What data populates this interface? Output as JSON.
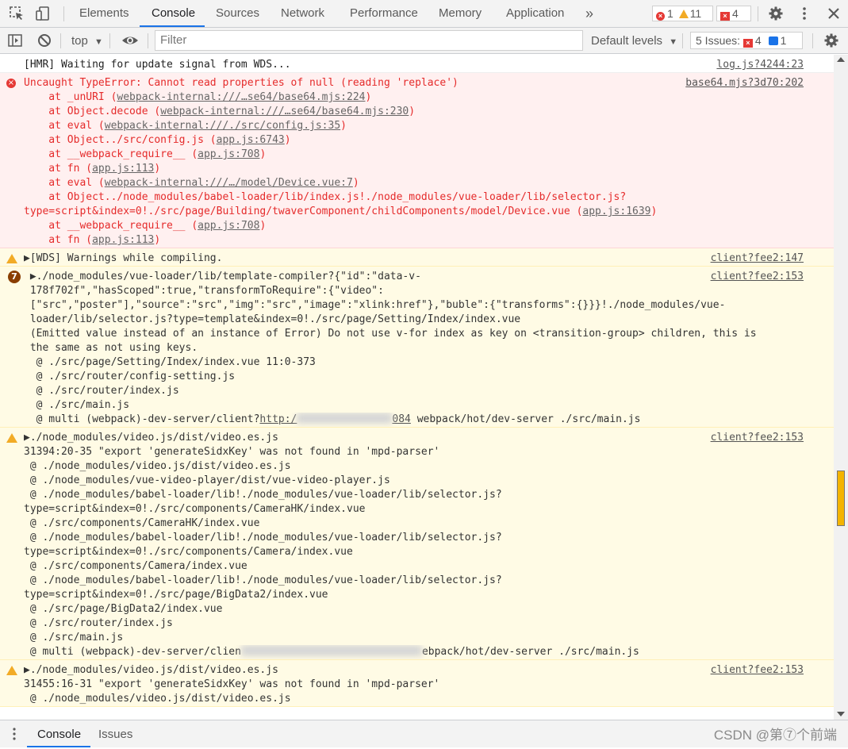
{
  "tabs": [
    "Elements",
    "Console",
    "Sources",
    "Network",
    "Performance",
    "Memory",
    "Application"
  ],
  "more_tabs_label": "»",
  "counts": {
    "errors": "1",
    "warnings": "11",
    "issues": "4"
  },
  "toolbar": {
    "context": "top",
    "filter_placeholder": "Filter",
    "levels": "Default levels",
    "issues_label": "5 Issues:",
    "issues_errors": "4",
    "issues_info": "1"
  },
  "messages": [
    {
      "type": "info",
      "source": "log.js?4244:23",
      "lines": [
        [
          {
            "t": "[HMR] Waiting for update signal from WDS..."
          }
        ]
      ]
    },
    {
      "type": "error",
      "source": "base64.mjs?3d70:202",
      "lines": [
        [
          {
            "t": "Uncaught TypeError: Cannot read properties of null (reading 'replace')"
          }
        ],
        [
          {
            "t": "    at _unURI ("
          },
          {
            "t": "webpack-internal:///…se64/base64.mjs:224",
            "link": true
          },
          {
            "t": ")"
          }
        ],
        [
          {
            "t": "    at Object.decode ("
          },
          {
            "t": "webpack-internal:///…se64/base64.mjs:230",
            "link": true
          },
          {
            "t": ")"
          }
        ],
        [
          {
            "t": "    at eval ("
          },
          {
            "t": "webpack-internal:///./src/config.js:35",
            "link": true
          },
          {
            "t": ")"
          }
        ],
        [
          {
            "t": "    at Object../src/config.js ("
          },
          {
            "t": "app.js:6743",
            "link": true
          },
          {
            "t": ")"
          }
        ],
        [
          {
            "t": "    at __webpack_require__ ("
          },
          {
            "t": "app.js:708",
            "link": true
          },
          {
            "t": ")"
          }
        ],
        [
          {
            "t": "    at fn ("
          },
          {
            "t": "app.js:113",
            "link": true
          },
          {
            "t": ")"
          }
        ],
        [
          {
            "t": "    at eval ("
          },
          {
            "t": "webpack-internal:///…/model/Device.vue:7",
            "link": true
          },
          {
            "t": ")"
          }
        ],
        [
          {
            "t": "    at Object../node_modules/babel-loader/lib/index.js!./node_modules/vue-loader/lib/selector.js?"
          }
        ],
        [
          {
            "t": "type=script&index=0!./src/page/Building/twaverComponent/childComponents/model/Device.vue ("
          },
          {
            "t": "app.js:1639",
            "link": true
          },
          {
            "t": ")"
          }
        ],
        [
          {
            "t": "    at __webpack_require__ ("
          },
          {
            "t": "app.js:708",
            "link": true
          },
          {
            "t": ")"
          }
        ],
        [
          {
            "t": "    at fn ("
          },
          {
            "t": "app.js:113",
            "link": true
          },
          {
            "t": ")"
          }
        ]
      ]
    },
    {
      "type": "warning",
      "source": "client?fee2:147",
      "lines": [
        [
          {
            "t": "▶[WDS] Warnings while compiling."
          }
        ]
      ]
    },
    {
      "type": "warning-count",
      "count": "7",
      "source": "client?fee2:153",
      "lines": [
        [
          {
            "t": " ▶./node_modules/vue-loader/lib/template-compiler?{\"id\":\"data-v-"
          }
        ],
        [
          {
            "t": " 178f702f\",\"hasScoped\":true,\"transformToRequire\":{\"video\":"
          }
        ],
        [
          {
            "t": " [\"src\",\"poster\"],\"source\":\"src\",\"img\":\"src\",\"image\":\"xlink:href\"},\"buble\":{\"transforms\":{}}}!./node_modules/vue-"
          }
        ],
        [
          {
            "t": " loader/lib/selector.js?type=template&index=0!./src/page/Setting/Index/index.vue"
          }
        ],
        [
          {
            "t": " (Emitted value instead of an instance of Error) Do not use v-for index as key on <transition-group> children, this is"
          }
        ],
        [
          {
            "t": " the same as not using keys."
          }
        ],
        [
          {
            "t": "  @ ./src/page/Setting/Index/index.vue 11:0-373"
          }
        ],
        [
          {
            "t": "  @ ./src/router/config-setting.js"
          }
        ],
        [
          {
            "t": "  @ ./src/router/index.js"
          }
        ],
        [
          {
            "t": "  @ ./src/main.js"
          }
        ],
        [
          {
            "t": "  @ multi (webpack)-dev-server/client?"
          },
          {
            "t": "http:/",
            "link": true
          },
          {
            "blur": 120
          },
          {
            "t": "084",
            "link": true
          },
          {
            "t": " webpack/hot/dev-server ./src/main.js"
          }
        ]
      ]
    },
    {
      "type": "warning",
      "source": "client?fee2:153",
      "lines": [
        [
          {
            "t": "▶./node_modules/video.js/dist/video.es.js"
          }
        ],
        [
          {
            "t": "31394:20-35 \"export 'generateSidxKey' was not found in 'mpd-parser'"
          }
        ],
        [
          {
            "t": " @ ./node_modules/video.js/dist/video.es.js"
          }
        ],
        [
          {
            "t": " @ ./node_modules/vue-video-player/dist/vue-video-player.js"
          }
        ],
        [
          {
            "t": " @ ./node_modules/babel-loader/lib!./node_modules/vue-loader/lib/selector.js?"
          }
        ],
        [
          {
            "t": "type=script&index=0!./src/components/CameraHK/index.vue"
          }
        ],
        [
          {
            "t": " @ ./src/components/CameraHK/index.vue"
          }
        ],
        [
          {
            "t": " @ ./node_modules/babel-loader/lib!./node_modules/vue-loader/lib/selector.js?"
          }
        ],
        [
          {
            "t": "type=script&index=0!./src/components/Camera/index.vue"
          }
        ],
        [
          {
            "t": " @ ./src/components/Camera/index.vue"
          }
        ],
        [
          {
            "t": " @ ./node_modules/babel-loader/lib!./node_modules/vue-loader/lib/selector.js?"
          }
        ],
        [
          {
            "t": "type=script&index=0!./src/page/BigData2/index.vue"
          }
        ],
        [
          {
            "t": " @ ./src/page/BigData2/index.vue"
          }
        ],
        [
          {
            "t": " @ ./src/router/index.js"
          }
        ],
        [
          {
            "t": " @ ./src/main.js"
          }
        ],
        [
          {
            "t": " @ multi (webpack)-dev-server/clien"
          },
          {
            "blur": 228
          },
          {
            "t": "ebpack/hot/dev-server ./src/main.js"
          }
        ]
      ]
    },
    {
      "type": "warning",
      "source": "client?fee2:153",
      "lines": [
        [
          {
            "t": "▶./node_modules/video.js/dist/video.es.js"
          }
        ],
        [
          {
            "t": "31455:16-31 \"export 'generateSidxKey' was not found in 'mpd-parser'"
          }
        ],
        [
          {
            "t": " @ ./node_modules/video.js/dist/video.es.js"
          }
        ]
      ]
    }
  ],
  "drawer_tabs": [
    "Console",
    "Issues"
  ],
  "watermark": "CSDN @第⑦个前端",
  "colors": {
    "error_bg": "#fff0f0",
    "warning_bg": "#fffbe5",
    "accent": "#1a73e8",
    "error": "#e52b2b",
    "warning": "#f2ab26"
  }
}
